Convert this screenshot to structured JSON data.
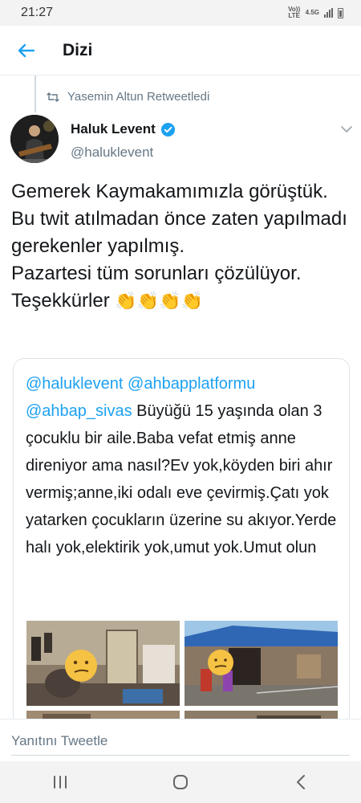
{
  "status_bar": {
    "time": "21:27",
    "volte_label": "Vo)) LTE",
    "network_label": "4.5G"
  },
  "header": {
    "back_icon": "arrow-left-icon",
    "title": "Dizi"
  },
  "retweet": {
    "icon": "retweet-icon",
    "text": "Yasemin Altun Retweetledi"
  },
  "tweet": {
    "author_name": "Haluk Levent",
    "author_handle": "@haluklevent",
    "verified": true,
    "text": "Gemerek Kaymakamımızla görüştük.\nBu twit atılmadan önce zaten yapılmadı gerekenler yapılmış.\nPazartesi tüm sorunları çözülüyor.\nTeşekkürler ",
    "emoji": "👏👏👏👏"
  },
  "quote": {
    "mention_1": "@haluklevent",
    "mention_2": "@ahbapplatformu",
    "mention_3": "@ahbap_sivas",
    "text": " Büyüğü 15 yaşında olan 3 çocuklu bir aile.Baba vefat etmiş anne direniyor ama nasıl?Ev yok,köyden biri ahır vermiş;anne,iki odalı eve çevirmiş.Çatı yok yatarken çocukların üzerine su akıyor.Yerde halı yok,elektirik yok,umut yok.Umut olun"
  },
  "reply": {
    "placeholder": "Yanıtını Tweetle"
  },
  "colors": {
    "accent": "#1da1f2",
    "verified": "#1da1f2",
    "muted": "#657786"
  }
}
